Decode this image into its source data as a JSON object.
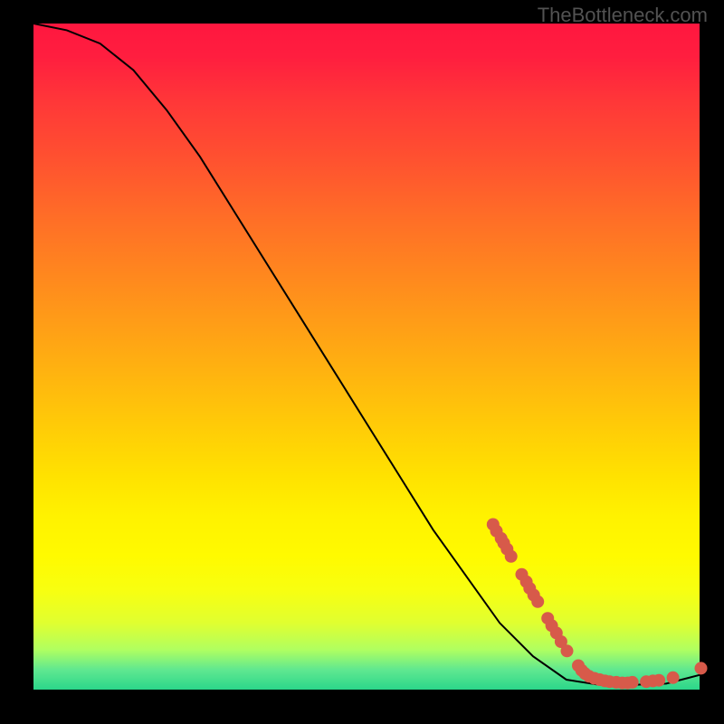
{
  "watermark": "TheBottleneck.com",
  "chart_data": {
    "type": "line",
    "title": "",
    "xlabel": "",
    "ylabel": "",
    "xlim": [
      0,
      100
    ],
    "ylim": [
      0,
      100
    ],
    "grid": false,
    "curve": [
      {
        "x": 0,
        "y": 100
      },
      {
        "x": 5,
        "y": 99
      },
      {
        "x": 10,
        "y": 97
      },
      {
        "x": 15,
        "y": 93
      },
      {
        "x": 20,
        "y": 87
      },
      {
        "x": 25,
        "y": 80
      },
      {
        "x": 30,
        "y": 72
      },
      {
        "x": 35,
        "y": 64
      },
      {
        "x": 40,
        "y": 56
      },
      {
        "x": 45,
        "y": 48
      },
      {
        "x": 50,
        "y": 40
      },
      {
        "x": 55,
        "y": 32
      },
      {
        "x": 60,
        "y": 24
      },
      {
        "x": 65,
        "y": 17
      },
      {
        "x": 70,
        "y": 10
      },
      {
        "x": 75,
        "y": 5
      },
      {
        "x": 80,
        "y": 1.5
      },
      {
        "x": 85,
        "y": 0.7
      },
      {
        "x": 90,
        "y": 0.7
      },
      {
        "x": 95,
        "y": 0.9
      },
      {
        "x": 100,
        "y": 2.2
      }
    ],
    "markers": [
      {
        "x": 69.0,
        "y": 24.8
      },
      {
        "x": 69.5,
        "y": 23.8
      },
      {
        "x": 70.2,
        "y": 22.7
      },
      {
        "x": 70.6,
        "y": 22.0
      },
      {
        "x": 71.1,
        "y": 21.1
      },
      {
        "x": 71.7,
        "y": 20.0
      },
      {
        "x": 73.3,
        "y": 17.3
      },
      {
        "x": 74.0,
        "y": 16.2
      },
      {
        "x": 74.5,
        "y": 15.2
      },
      {
        "x": 75.1,
        "y": 14.2
      },
      {
        "x": 75.7,
        "y": 13.2
      },
      {
        "x": 77.2,
        "y": 10.7
      },
      {
        "x": 77.8,
        "y": 9.6
      },
      {
        "x": 78.5,
        "y": 8.5
      },
      {
        "x": 79.2,
        "y": 7.2
      },
      {
        "x": 80.1,
        "y": 5.8
      },
      {
        "x": 81.8,
        "y": 3.6
      },
      {
        "x": 82.3,
        "y": 2.9
      },
      {
        "x": 82.8,
        "y": 2.4
      },
      {
        "x": 83.4,
        "y": 2.0
      },
      {
        "x": 84.2,
        "y": 1.7
      },
      {
        "x": 85.0,
        "y": 1.5
      },
      {
        "x": 85.8,
        "y": 1.3
      },
      {
        "x": 86.5,
        "y": 1.2
      },
      {
        "x": 87.5,
        "y": 1.1
      },
      {
        "x": 88.4,
        "y": 1.0
      },
      {
        "x": 89.2,
        "y": 1.0
      },
      {
        "x": 89.9,
        "y": 1.1
      },
      {
        "x": 92.0,
        "y": 1.2
      },
      {
        "x": 93.0,
        "y": 1.3
      },
      {
        "x": 93.9,
        "y": 1.4
      },
      {
        "x": 96.0,
        "y": 1.8
      },
      {
        "x": 100.2,
        "y": 3.2
      }
    ],
    "marker_color": "#d75a4a",
    "line_color": "#000000"
  }
}
